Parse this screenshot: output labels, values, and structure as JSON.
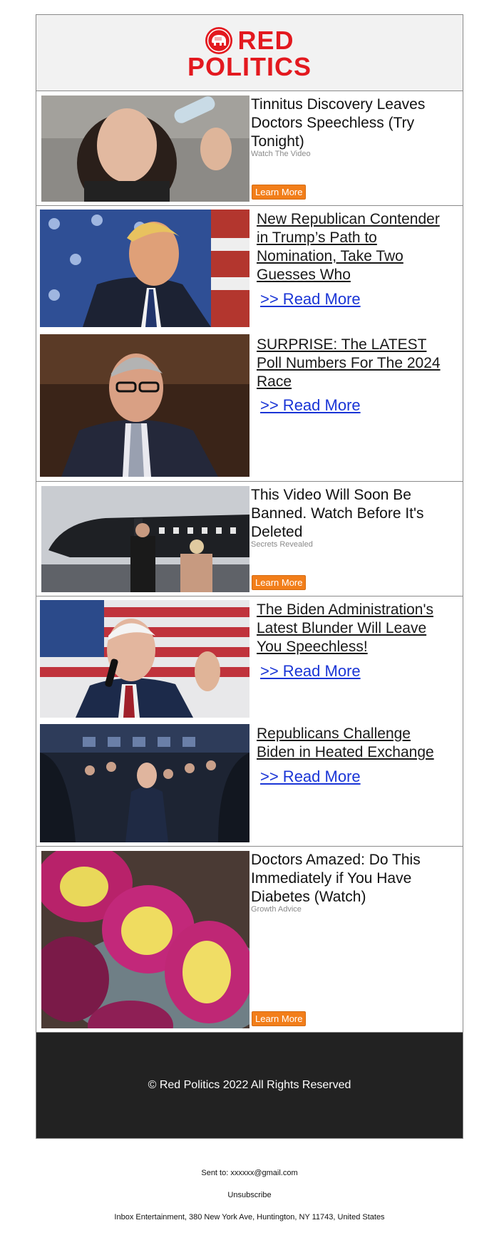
{
  "brand": {
    "line1": "RED",
    "line2": "POLITICS",
    "color": "#e3191f"
  },
  "ads": [
    {
      "title": "Tinnitus Discovery Leaves Doctors Speechless (Try Tonight)",
      "source": "Watch The Video",
      "button": "Learn More"
    },
    {
      "title": "This Video Will Soon Be Banned. Watch Before It's Deleted",
      "source": "Secrets Revealed",
      "button": "Learn More"
    },
    {
      "title": "Doctors Amazed: Do This Immediately if You Have Diabetes (Watch)",
      "source": "Growth Advice",
      "button": "Learn More"
    }
  ],
  "articles": [
    {
      "title": "New Republican Contender in Trump’s Path to Nomination, Take Two Guesses Who",
      "link": ">> Read More"
    },
    {
      "title": "SURPRISE: The LATEST Poll Numbers For The 2024 Race",
      "link": ">> Read More"
    },
    {
      "title": "The Biden Administration's Latest Blunder Will Leave You Speechless!",
      "link": ">> Read More"
    },
    {
      "title": "Republicans Challenge Biden in Heated Exchange",
      "link": ">> Read More"
    }
  ],
  "footer": {
    "copyright": "© Red Politics 2022 All Rights Reserved"
  },
  "meta": {
    "sent_to": "Sent to: xxxxxx@gmail.com",
    "unsubscribe": "Unsubscribe",
    "address": "Inbox Entertainment, 380 New York Ave, Huntington, NY 11743, United States"
  },
  "colors": {
    "accent_button": "#f27e1a",
    "link": "#1a35d6",
    "footer_bg": "#222222"
  }
}
